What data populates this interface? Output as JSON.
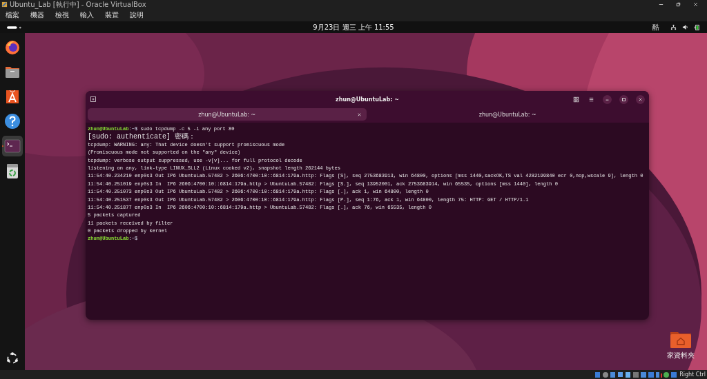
{
  "host_window": {
    "title": "Ubuntu_Lab [執行中] - Oracle VirtualBox"
  },
  "host_menu": [
    "檔案",
    "機器",
    "檢視",
    "輸入",
    "裝置",
    "說明"
  ],
  "top_bar": {
    "clock": "9月23日 週三 上午 11:55",
    "input_method": "酷"
  },
  "dock": {
    "items": [
      {
        "kind": "firefox",
        "running": false
      },
      {
        "kind": "files",
        "running": false
      },
      {
        "kind": "store",
        "running": false
      },
      {
        "kind": "help",
        "running": false
      },
      {
        "kind": "terminal",
        "running": true
      },
      {
        "kind": "trash",
        "running": false
      }
    ]
  },
  "terminal": {
    "title": "zhun@UbuntuLab: ~",
    "tabs": [
      {
        "label": "zhun@UbuntuLab: ~",
        "selected": true
      },
      {
        "label": "zhun@UbuntuLab: ~",
        "selected": false
      }
    ],
    "lines": [
      {
        "kind": "prompt",
        "user_host": "zhun@UbuntuLab",
        "sigil": ":~$",
        "command": "sudo tcpdump -c 5 -i any port 80"
      },
      {
        "kind": "output",
        "text": "[sudo: authenticate] 密碼："
      },
      {
        "kind": "output",
        "text": "tcpdump: WARNING: any: That device doesn't support promiscuous mode"
      },
      {
        "kind": "output",
        "text": "(Promiscuous mode not supported on the \"any\" device)"
      },
      {
        "kind": "output",
        "text": "tcpdump: verbose output suppressed, use -v[v]... for full protocol decode"
      },
      {
        "kind": "output",
        "text": "listening on any, link-type LINUX_SLL2 (Linux cooked v2), snapshot length 262144 bytes"
      },
      {
        "kind": "output",
        "text": "11:54:40.234210 enp0s3 Out IP6 UbuntuLab.57482 > 2606:4700:10::6814:179a.http: Flags [S], seq 2753683913, win 64800, options [mss 1440,sackOK,TS val 4282199840 ecr 0,nop,wscale 9], length 0"
      },
      {
        "kind": "output",
        "text": "11:54:40.251019 enp0s3 In  IP6 2606:4700:10::6814:179a.http > UbuntuLab.57482: Flags [S.], seq 13952001, ack 2753683914, win 65535, options [mss 1440], length 0"
      },
      {
        "kind": "output",
        "text": "11:54:40.251073 enp0s3 Out IP6 UbuntuLab.57482 > 2606:4700:10::6814:179a.http: Flags [.], ack 1, win 64800, length 0"
      },
      {
        "kind": "output",
        "text": "11:54:40.251537 enp0s3 Out IP6 UbuntuLab.57482 > 2606:4700:10::6814:179a.http: Flags [P.], seq 1:76, ack 1, win 64800, length 75: HTTP: GET / HTTP/1.1"
      },
      {
        "kind": "output",
        "text": "11:54:40.251877 enp0s3 In  IP6 2606:4700:10::6814:179a.http > UbuntuLab.57482: Flags [.], ack 76, win 65535, length 0"
      },
      {
        "kind": "output",
        "text": "5 packets captured"
      },
      {
        "kind": "output",
        "text": "11 packets received by filter"
      },
      {
        "kind": "output",
        "text": "0 packets dropped by kernel"
      },
      {
        "kind": "prompt",
        "user_host": "zhun@UbuntuLab",
        "sigil": ":~$"
      }
    ]
  },
  "desktop_icons": [
    {
      "label": "家資料夾"
    }
  ],
  "host_status": {
    "key": "Right Ctrl"
  }
}
